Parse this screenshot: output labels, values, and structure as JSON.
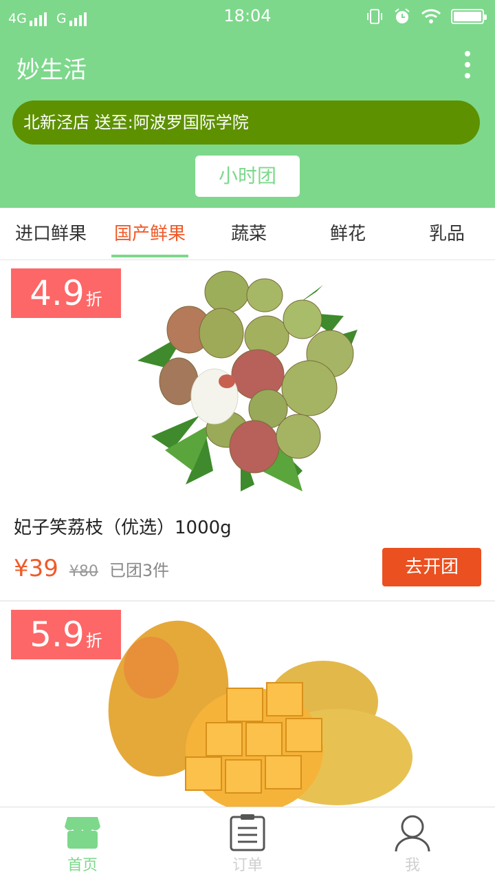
{
  "status_bar": {
    "network_1": "4G",
    "network_2": "G",
    "time": "18:04"
  },
  "header": {
    "app_title": "妙生活",
    "address": "北新泾店 送至:阿波罗国际学院",
    "hour_group_label": "小时团"
  },
  "tabs": [
    {
      "label": "进口鲜果",
      "active": false
    },
    {
      "label": "国产鲜果",
      "active": true
    },
    {
      "label": "蔬菜",
      "active": false
    },
    {
      "label": "鲜花",
      "active": false
    },
    {
      "label": "乳品",
      "active": false
    }
  ],
  "products": [
    {
      "discount_num": "4.9",
      "discount_unit": "折",
      "image_icon": "lychee-image",
      "title": "妃子笑荔枝（优选）1000g",
      "price": "¥39",
      "original_price": "¥80",
      "sold": "已团3件",
      "button_label": "去开团"
    },
    {
      "discount_num": "5.9",
      "discount_unit": "折",
      "image_icon": "mango-image"
    }
  ],
  "bottom_nav": [
    {
      "label": "首页",
      "icon": "store-icon",
      "active": true
    },
    {
      "label": "订单",
      "icon": "clipboard-icon",
      "active": false
    },
    {
      "label": "我",
      "icon": "user-icon",
      "active": false
    }
  ],
  "colors": {
    "header_green": "#7dd88b",
    "address_green": "#5d9100",
    "accent_orange": "#f05a28",
    "discount_red": "#fd6767",
    "button_orange": "#eb5020"
  }
}
